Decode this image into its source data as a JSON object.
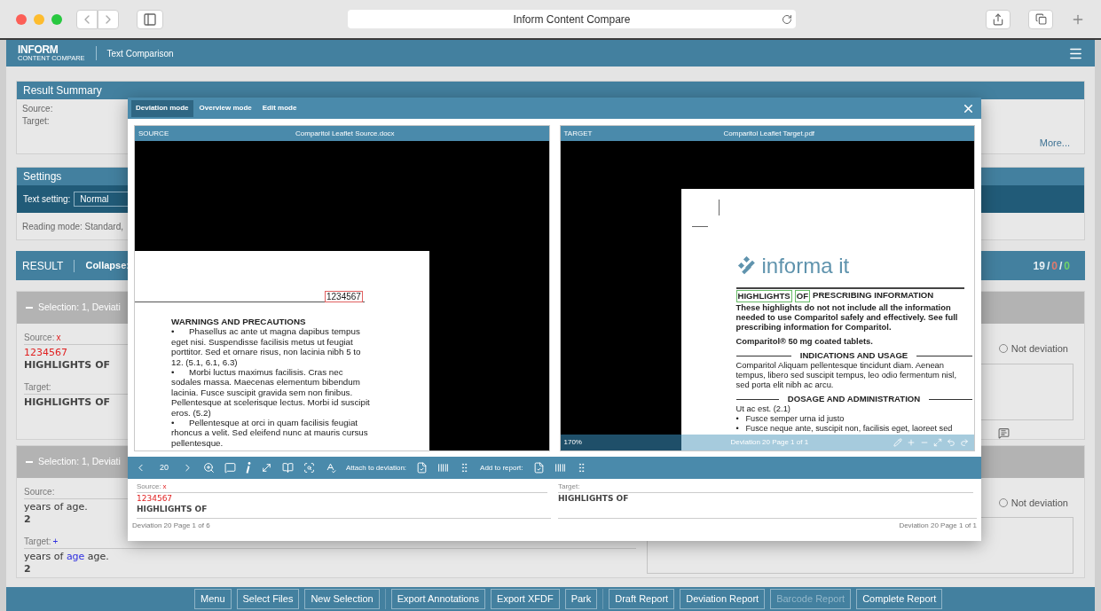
{
  "browser": {
    "title": "Inform Content Compare"
  },
  "app_header": {
    "logo": "INFORM",
    "logo_sub": "CONTENT COMPARE",
    "title": "Text Comparison"
  },
  "result_summary": {
    "title": "Result Summary",
    "labels": [
      "Source:",
      "Target:"
    ],
    "more_link": "More..."
  },
  "settings": {
    "title": "Settings",
    "text_setting_label": "Text setting:",
    "text_setting_value": "Normal",
    "reading_mode": "Reading mode: Standard,"
  },
  "result_bar": {
    "title": "RESULT",
    "collapse_label": "Collapse:",
    "separator": "/",
    "counts": [
      {
        "value": "19",
        "color": "#e6eef3"
      },
      {
        "value": "0",
        "color": "#e07a6e"
      },
      {
        "value": "0",
        "color": "#6fd26a"
      }
    ]
  },
  "selections": [
    {
      "title": "Selection: 1, Deviati",
      "expanded": true,
      "source_label": "Source:",
      "source_mark": {
        "text": "x",
        "kind": "deleted"
      },
      "source_lines": [
        [
          {
            "text": "1234567",
            "kind": "deleted"
          }
        ],
        [
          {
            "text": "HIGHLIGHTS OF",
            "kind": "bold"
          }
        ]
      ],
      "target_label": "Target:",
      "target_lines": [
        [
          {
            "text": "HIGHLIGHTS OF",
            "kind": "bold"
          }
        ]
      ],
      "radio_label": "Not deviation",
      "radio_selected": false
    },
    {
      "title": "Selection: 1, Deviati",
      "expanded": true,
      "source_label": "Source:",
      "source_lines": [
        [
          {
            "text": "years of age.",
            "kind": "plain"
          }
        ],
        [
          {
            "text": "2",
            "kind": "bold"
          }
        ]
      ],
      "target_label": "Target:",
      "target_mark": {
        "text": "+",
        "kind": "inserted"
      },
      "target_lines": [
        [
          {
            "text": "years of ",
            "kind": "plain"
          },
          {
            "text": "age",
            "kind": "inserted"
          },
          {
            "text": " age.",
            "kind": "plain"
          }
        ],
        [
          {
            "text": "2",
            "kind": "bold"
          }
        ]
      ],
      "radio_label": "Not deviation",
      "radio_selected": false
    }
  ],
  "modal": {
    "tabs": [
      {
        "label": "Deviation mode",
        "selected": true
      },
      {
        "label": "Overview mode",
        "selected": false
      },
      {
        "label": "Edit mode",
        "selected": false
      }
    ],
    "source_pane": {
      "label": "SOURCE",
      "file": "Comparitol Leaflet Source.docx",
      "marked_number": "1234567",
      "heading": "WARNINGS AND PRECAUTIONS",
      "bullet": "•",
      "bullets": [
        "Phasellus ac ante ut magna dapibus tempus eget nisi. Suspendisse facilisis metus ut feugiat porttitor. Sed et ornare risus, non lacinia nibh 5 to 12. (5.1, 6.1, 6.3)",
        "Morbi luctus maximus facilisis. Cras nec sodales massa. Maecenas elementum bibendum lacinia. Fusce suscipit gravida sem non finibus. Pellentesque at scelerisque lectus. Morbi id suscipit eros. (5.2)",
        "Pellentesque at orci in quam facilisis feugiat rhoncus a velit. Sed eleifend nunc at mauris cursus pellentesque."
      ]
    },
    "target_pane": {
      "label": "TARGET",
      "file": "Comparitol Leaflet Target.pdf",
      "logo": "informa it",
      "heading": [
        {
          "text": "HIGHLIGHTS",
          "kind": "matched"
        },
        {
          "text": "OF",
          "kind": "matched"
        },
        {
          "text": "PRESCRIBING INFORMATION",
          "kind": "plain"
        }
      ],
      "intro": "These highlights do not not include all the information needed to use Comparitol safely and effectively. See full prescribing information for Comparitol.",
      "product": "Comparitol® 50 mg coated tablets.",
      "sections": [
        {
          "title": "INDICATIONS AND USAGE",
          "lead": "Comparitol Aliquam pellentesque tincidunt diam. Aenean tempus, libero sed suscipit tempus, leo odio fermentum nisl, sed porta elit nibh ac arcu."
        },
        {
          "title": "DOSAGE AND ADMINISTRATION",
          "lead": "Ut ac est. (2.1)",
          "bullet": "•",
          "bullets": [
            "Fusce semper urna id justo",
            "Fusce neque ante, suscipit non, facilisis eget, laoreet sed"
          ]
        }
      ],
      "zoom": "170%",
      "status": "Deviation 20 Page 1 of 1"
    },
    "toolbar": {
      "page": "20",
      "attach_label": "Attach to deviation:",
      "report_label": "Add to report:"
    },
    "detail": {
      "source_label": "Source:",
      "source_mark": {
        "text": "x",
        "kind": "deleted"
      },
      "source_lines": [
        [
          {
            "text": "1234567",
            "kind": "deleted"
          }
        ],
        [
          {
            "text": "HIGHLIGHTS OF",
            "kind": "bold"
          }
        ]
      ],
      "target_label": "Target:",
      "target_lines": [
        [
          {
            "text": "HIGHLIGHTS OF",
            "kind": "bold"
          }
        ]
      ],
      "source_footer": "Deviation 20 Page 1 of 6",
      "target_footer": "Deviation 20 Page 1 of 1"
    }
  },
  "bottom_bar": [
    [
      {
        "label": "Menu",
        "disabled": false
      },
      {
        "label": "Select Files",
        "disabled": false
      },
      {
        "label": "New Selection",
        "disabled": false
      }
    ],
    [
      {
        "label": "Export Annotations",
        "disabled": false
      },
      {
        "label": "Export XFDF",
        "disabled": false
      },
      {
        "label": "Park",
        "disabled": false
      }
    ],
    [
      {
        "label": "Draft Report",
        "disabled": false
      },
      {
        "label": "Deviation Report",
        "disabled": false
      },
      {
        "label": "Barcode Report",
        "disabled": true
      },
      {
        "label": "Complete Report",
        "disabled": false
      }
    ]
  ]
}
